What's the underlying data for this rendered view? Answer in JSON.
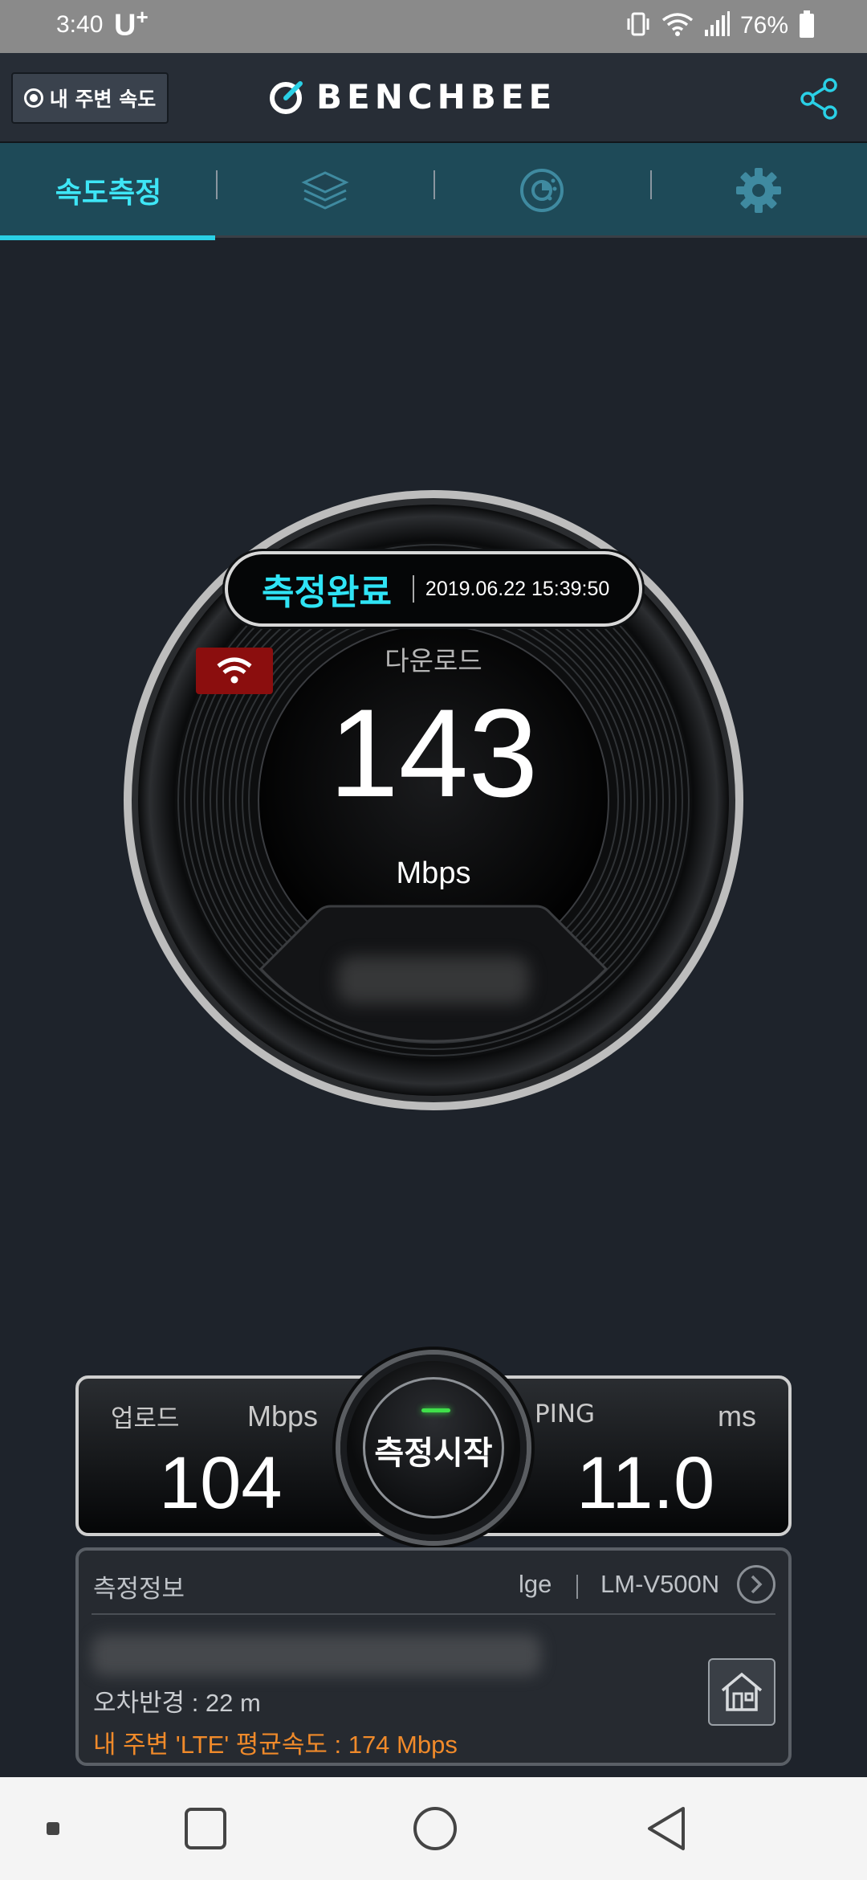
{
  "status_bar": {
    "time": "3:40",
    "carrier": "U",
    "carrier_sup": "+",
    "battery": "76%",
    "icons": [
      "vibrate-icon",
      "wifi-icon",
      "signal-icon",
      "battery-icon"
    ]
  },
  "header": {
    "nearby_button_label": "내 주변 속도",
    "logo_text": "BENCHBEE",
    "share_icon": "share-icon"
  },
  "tabs": [
    {
      "label": "속도측정",
      "active": true
    },
    {
      "icon": "layers-icon",
      "active": false
    },
    {
      "icon": "pie-chart-icon",
      "active": false
    },
    {
      "icon": "gear-icon",
      "active": false
    }
  ],
  "gauge": {
    "status": "측정완료",
    "timestamp": "2019.06.22 15:39:50",
    "connection_icon": "wifi-icon",
    "download_label": "다운로드",
    "download_value": "143",
    "download_unit": "Mbps"
  },
  "results": {
    "upload_label": "업로드",
    "upload_unit": "Mbps",
    "upload_value": "104",
    "ping_label": "PING",
    "ping_unit": "ms",
    "ping_value": "11.0",
    "start_button_label": "측정시작"
  },
  "info": {
    "title": "측정정보",
    "carrier": "lge",
    "model": "LM-V500N",
    "error_radius": "오차반경 : 22 m",
    "nearby_average": "내 주변 'LTE' 평균속도 :  174 Mbps"
  },
  "colors": {
    "accent": "#2fe4f5",
    "background": "#1e232b",
    "tab_bar": "#1e4a58",
    "warning_text": "#f08a2a",
    "wifi_badge": "#8b0e0e",
    "led": "#3fe04a"
  }
}
